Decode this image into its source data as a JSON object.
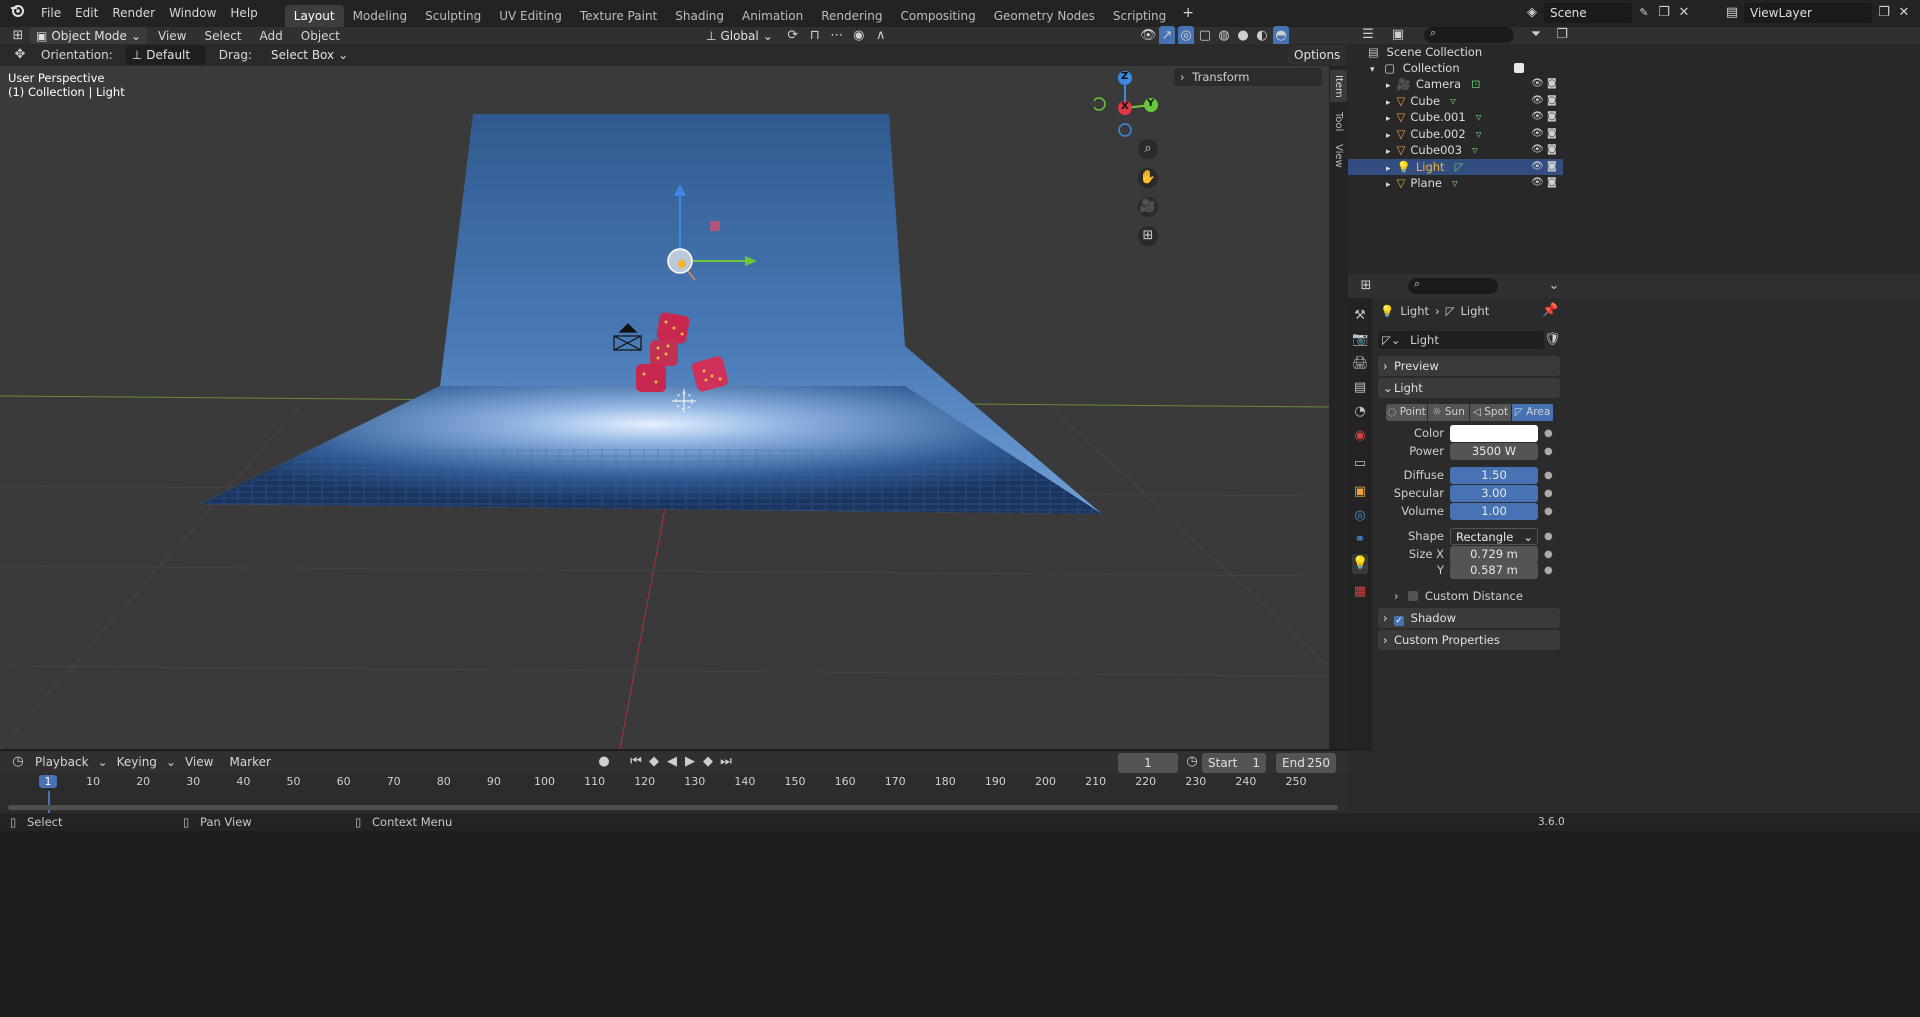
{
  "menu": {
    "file": "File",
    "edit": "Edit",
    "render": "Render",
    "window": "Window",
    "help": "Help"
  },
  "workspaces": [
    "Layout",
    "Modeling",
    "Sculpting",
    "UV Editing",
    "Texture Paint",
    "Shading",
    "Animation",
    "Rendering",
    "Compositing",
    "Geometry Nodes",
    "Scripting"
  ],
  "active_workspace": "Layout",
  "scene_field": "Scene",
  "viewlayer_field": "ViewLayer",
  "viewport_header": {
    "mode": "Object Mode",
    "view": "View",
    "select": "Select",
    "add": "Add",
    "object": "Object",
    "transform_orientation": "Global"
  },
  "tool_header": {
    "orientation_label": "Orientation:",
    "orientation_value": "Default",
    "drag_label": "Drag:",
    "drag_value": "Select Box",
    "options": "Options"
  },
  "overlay_text": {
    "perspective": "User Perspective",
    "collection": "(1) Collection | Light"
  },
  "sidebar": {
    "transform": "Transform",
    "tabs": [
      "Item",
      "Tool",
      "View"
    ]
  },
  "gizmo": {
    "z": "Z",
    "y": "Y",
    "x": "X"
  },
  "outliner": {
    "scene_collection": "Scene Collection",
    "collection": "Collection",
    "items": [
      {
        "name": "Camera",
        "type": "camera",
        "selected": false
      },
      {
        "name": "Cube",
        "type": "mesh",
        "selected": false
      },
      {
        "name": "Cube.001",
        "type": "mesh",
        "selected": false
      },
      {
        "name": "Cube.002",
        "type": "mesh",
        "selected": false
      },
      {
        "name": "Cube003",
        "type": "mesh",
        "selected": false
      },
      {
        "name": "Light",
        "type": "light",
        "selected": true
      },
      {
        "name": "Plane",
        "type": "mesh",
        "selected": false
      }
    ]
  },
  "properties": {
    "breadcrumb_object": "Light",
    "breadcrumb_data": "Light",
    "datablock_name": "Light",
    "panels": {
      "preview": "Preview",
      "light": "Light",
      "custom_distance": "Custom Distance",
      "shadow": "Shadow",
      "custom_properties": "Custom Properties"
    },
    "light_types": [
      "Point",
      "Sun",
      "Spot",
      "Area"
    ],
    "active_light_type": "Area",
    "color_label": "Color",
    "color_value": "#ffffff",
    "power_label": "Power",
    "power": "3500 W",
    "diffuse_label": "Diffuse",
    "diffuse": "1.50",
    "specular_label": "Specular",
    "specular": "3.00",
    "volume_label": "Volume",
    "volume": "1.00",
    "shape_label": "Shape",
    "shape": "Rectangle",
    "size_x_label": "Size X",
    "size_x": "0.729 m",
    "size_y_label": "Y",
    "size_y": "0.587 m",
    "shadow_checked": true,
    "custom_distance_checked": false
  },
  "timeline": {
    "playback": "Playback",
    "keying": "Keying",
    "view": "View",
    "marker": "Marker",
    "current_frame": "1",
    "start_label": "Start",
    "start": "1",
    "end_label": "End",
    "end": "250",
    "ruler": [
      "1",
      "10",
      "20",
      "30",
      "40",
      "50",
      "60",
      "70",
      "80",
      "90",
      "100",
      "110",
      "120",
      "130",
      "140",
      "150",
      "160",
      "170",
      "180",
      "190",
      "200",
      "210",
      "220",
      "230",
      "240",
      "250"
    ]
  },
  "statusbar": {
    "select": "Select",
    "pan": "Pan View",
    "context": "Context Menu",
    "version": "3.6.0"
  },
  "colors": {
    "accent": "#4772b3",
    "selected_row": "#334d80",
    "light_orange": "#e8a33a",
    "die": "#c8284f",
    "backdrop": "#3d6aa3"
  }
}
